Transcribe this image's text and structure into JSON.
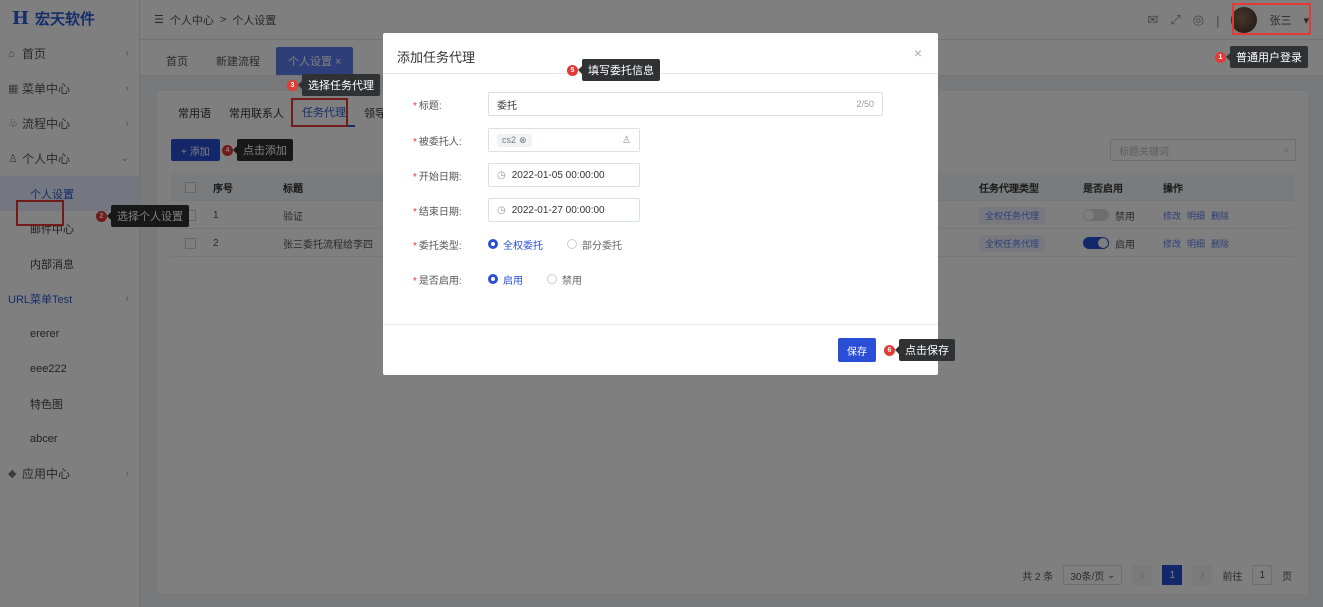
{
  "app": {
    "logo_mark": "H",
    "logo_text": "宏天软件"
  },
  "sidebar": {
    "items": [
      {
        "icon": "⌂",
        "label": "首页",
        "arrow": "›"
      },
      {
        "icon": "▦",
        "label": "菜单中心",
        "arrow": "›"
      },
      {
        "icon": "♧",
        "label": "流程中心",
        "arrow": "›"
      },
      {
        "icon": "♙",
        "label": "个人中心",
        "arrow": "⌄"
      },
      {
        "label": "个人设置"
      },
      {
        "label": "邮件中心"
      },
      {
        "label": "内部消息"
      },
      {
        "label": "URL菜单Test",
        "arrow": "›"
      },
      {
        "label": "ererer"
      },
      {
        "label": "eee222"
      },
      {
        "label": "特色图"
      },
      {
        "label": "abcer"
      },
      {
        "icon": "◆",
        "label": "应用中心",
        "arrow": "›"
      }
    ]
  },
  "topbar": {
    "breadcrumb_icon": "☰",
    "breadcrumb": [
      "个人中心",
      "个人设置"
    ],
    "separator": ">",
    "user_name": "张三",
    "user_arrow": "▾"
  },
  "tabs": [
    {
      "label": "首页"
    },
    {
      "label": "新建流程"
    },
    {
      "label": "个人设置 ×"
    }
  ],
  "subtabs": [
    "常用语",
    "常用联系人",
    "任务代理",
    "领导"
  ],
  "toolbar": {
    "add_label": "+ 添加",
    "search_placeholder": "标题关键词"
  },
  "table": {
    "headers": {
      "index": "序号",
      "title": "标题",
      "type": "任务代理类型",
      "enabled": "是否启用",
      "ops": "操作"
    },
    "rows": [
      {
        "index": "1",
        "title": "验证",
        "type": "全权任务代理",
        "enabled": "禁用",
        "ops": [
          "修改",
          "明细",
          "删除"
        ]
      },
      {
        "index": "2",
        "title": "张三委托流程给李四",
        "type": "全权任务代理",
        "enabled": "启用",
        "ops": [
          "修改",
          "明细",
          "删除"
        ]
      }
    ]
  },
  "pager": {
    "total": "共 2 条",
    "page_size": "30条/页",
    "current": "1",
    "goto_label": "前往",
    "goto_value": "1",
    "goto_unit": "页"
  },
  "modal": {
    "title": "添加任务代理",
    "fields": {
      "title_label": "标题:",
      "title_value": "委托",
      "title_counter": "2/50",
      "delegate_label": "被委托人:",
      "delegate_value": "cs2",
      "start_label": "开始日期:",
      "start_value": "2022-01-05 00:00:00",
      "end_label": "结束日期:",
      "end_value": "2022-01-27 00:00:00",
      "type_label": "委托类型:",
      "type_option_1": "全权委托",
      "type_option_2": "部分委托",
      "enabled_label": "是否启用:",
      "enabled_option_1": "启用",
      "enabled_option_2": "禁用"
    },
    "save_label": "保存"
  },
  "callouts": {
    "c1": {
      "num": "1",
      "text": "普通用户登录"
    },
    "c2": {
      "num": "2",
      "text": "选择个人设置"
    },
    "c3": {
      "num": "3",
      "text": "选择任务代理"
    },
    "c4": {
      "num": "4",
      "text": "点击添加"
    },
    "c5": {
      "num": "5",
      "text": "填写委托信息"
    },
    "c6": {
      "num": "6",
      "text": "点击保存"
    }
  }
}
